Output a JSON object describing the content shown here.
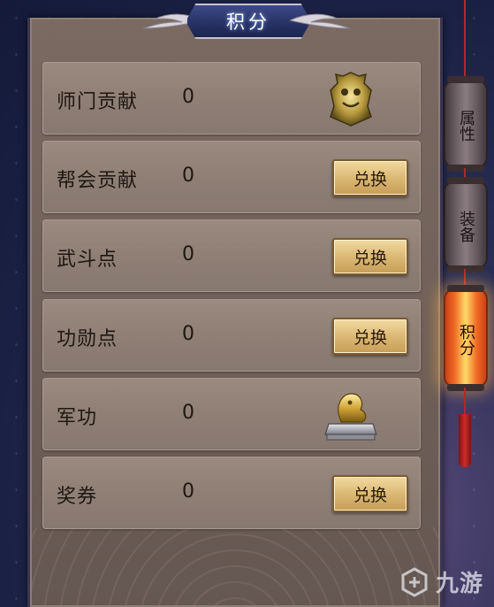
{
  "title": "积分",
  "rows": [
    {
      "label": "师门贡献",
      "value": "0",
      "action": null,
      "icon": "bronze-beast-token-icon"
    },
    {
      "label": "帮会贡献",
      "value": "0",
      "action": "兑换",
      "icon": null
    },
    {
      "label": "武斗点",
      "value": "0",
      "action": "兑换",
      "icon": null
    },
    {
      "label": "功勋点",
      "value": "0",
      "action": "兑换",
      "icon": null
    },
    {
      "label": "军功",
      "value": "0",
      "action": null,
      "icon": "golden-lion-seal-icon"
    },
    {
      "label": "奖券",
      "value": "0",
      "action": "兑换",
      "icon": null
    }
  ],
  "tabs": [
    {
      "label": "属性",
      "active": false
    },
    {
      "label": "装备",
      "active": false
    },
    {
      "label": "积分",
      "active": true
    }
  ],
  "watermark": {
    "text": "九游",
    "logo": "jiuyou-logo-icon"
  },
  "colors": {
    "button": "#d9b671",
    "active_lantern": "#f06a24",
    "panel": "#7a6a62",
    "title_plate": "#283366"
  }
}
